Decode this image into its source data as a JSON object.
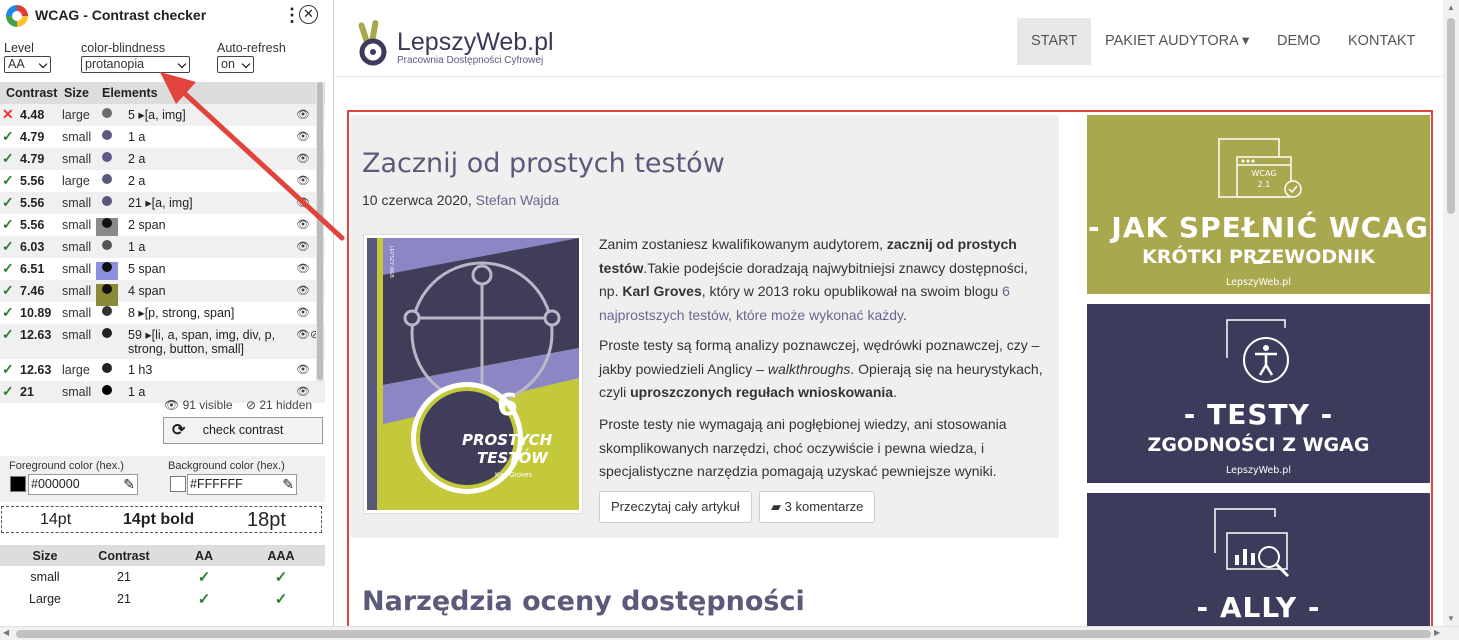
{
  "ext": {
    "title": "WCAG - Contrast checker",
    "menu_glyph": "⋮",
    "close_glyph": "✕",
    "level_label": "Level",
    "level_value": "AA",
    "cb_label": "color-blindness",
    "cb_value": "protanopia",
    "refresh_label": "Auto-refresh",
    "refresh_value": "on",
    "headers": {
      "contrast": "Contrast",
      "size": "Size",
      "elements": "Elements"
    },
    "rows": [
      {
        "ok": false,
        "contrast": "4.48",
        "size": "large",
        "swatch": "",
        "dot": "#6b6b6b",
        "count": "5 ▸[a, img]"
      },
      {
        "ok": true,
        "contrast": "4.79",
        "size": "small",
        "swatch": "",
        "dot": "#5c5a85",
        "count": "1 a"
      },
      {
        "ok": true,
        "contrast": "4.79",
        "size": "small",
        "swatch": "",
        "dot": "#5c5a85",
        "count": "2 a"
      },
      {
        "ok": true,
        "contrast": "5.56",
        "size": "large",
        "swatch": "",
        "dot": "#58587a",
        "count": "2 a"
      },
      {
        "ok": true,
        "contrast": "5.56",
        "size": "small",
        "swatch": "",
        "dot": "#58587a",
        "count": "21 ▸[a, img]"
      },
      {
        "ok": true,
        "contrast": "5.56",
        "size": "small",
        "swatch": "#8a8a8a",
        "dot": "#111111",
        "count": "2 span"
      },
      {
        "ok": true,
        "contrast": "6.03",
        "size": "small",
        "swatch": "",
        "dot": "#555555",
        "count": "1 a"
      },
      {
        "ok": true,
        "contrast": "6.51",
        "size": "small",
        "swatch": "#8a8fe0",
        "dot": "#111111",
        "count": "5 span"
      },
      {
        "ok": true,
        "contrast": "7.46",
        "size": "small",
        "swatch": "#8a8a3a",
        "dot": "#111111",
        "count": "4 span"
      },
      {
        "ok": true,
        "contrast": "10.89",
        "size": "small",
        "swatch": "",
        "dot": "#333333",
        "count": "8 ▸[p, strong, span]"
      },
      {
        "ok": true,
        "contrast": "12.63",
        "size": "small",
        "swatch": "",
        "dot": "#222222",
        "count": "59 ▸[li, a, span, img, div, p, strong, button, small]",
        "tall": true
      },
      {
        "ok": true,
        "contrast": "12.63",
        "size": "large",
        "swatch": "",
        "dot": "#222222",
        "count": "1 h3"
      },
      {
        "ok": true,
        "contrast": "21",
        "size": "small",
        "swatch": "",
        "dot": "#000000",
        "count": "1 a"
      }
    ],
    "visible": "👁 91 visible",
    "hidden": "21 hidden",
    "check_label": "check contrast",
    "fg_label": "Foreground color (hex.)",
    "fg_value": "#000000",
    "bg_label": "Background color (hex.)",
    "bg_value": "#FFFFFF",
    "sample_1": "14pt",
    "sample_2": "14pt bold",
    "sample_3": "18pt",
    "summary_headers": {
      "size": "Size",
      "contrast": "Contrast",
      "aa": "AA",
      "aaa": "AAA"
    },
    "summary_rows": [
      {
        "size": "small",
        "contrast": "21"
      },
      {
        "size": "Large",
        "contrast": "21"
      }
    ]
  },
  "site": {
    "logo_title": "LepszyWeb.pl",
    "logo_sub": "Pracownia Dostępności Cyfrowej",
    "nav": [
      "START",
      "PAKIET AUDYTORA ▾",
      "DEMO",
      "KONTAKT"
    ],
    "article_title": "Zacznij od prostych testów",
    "date": "10 czerwca 2020,",
    "author": "Stefan Wajda",
    "book_title_1": "PROSTYCH",
    "book_title_2": "TESTÓW",
    "book_num": "6",
    "book_author": "Karl Groves",
    "book_side": "LEPSZY WEB",
    "p1_a": "Zanim zostaniesz kwalifikowanym audytorem, ",
    "p1_b": "zacznij od prostych testów",
    "p1_c": ".Takie podejście doradzają najwybitniejsi znawcy dostępności, np. ",
    "p1_d": "Karl Groves",
    "p1_e": ", który w 2013 roku opublikował na swoim blogu ",
    "p1_link": "6 najprostszych testów, które może wykonać każdy",
    "p1_f": ".",
    "p2_a": "Proste testy są formą analizy poznawczej, wędrówki poznawczej, czy – jakby powiedzieli Anglicy – ",
    "p2_em": "walkthroughs",
    "p2_b": ". Opierają się na heurystykach, czyli ",
    "p2_strong": "uproszczonych regułach wnioskowania",
    "p2_c": ".",
    "p3": "Proste testy nie wymagają ani pogłębionej wiedzy, ani stosowania skomplikowanych narzędzi, choć oczywiście i pewna wiedza, i specjalistyczne narzędzia pomagają uzyskać pewniejsze wyniki.",
    "btn_read": "Przeczytaj cały artykuł",
    "btn_comments": "3 komentarze",
    "section_title": "Narzędzia oceny dostępności",
    "banner1": {
      "line1": "- JAK SPEŁNIĆ WCAG -",
      "line2": "KRÓTKI PRZEWODNIK",
      "site": "LepszyWeb.pl",
      "badge": "WCAG",
      "badge_ver": "2.1",
      "color": "#a9a84e"
    },
    "banner2": {
      "line1": "- TESTY -",
      "line2": "ZGODNOŚCI Z WGAG",
      "site": "LepszyWeb.pl",
      "color": "#3d3b5c"
    },
    "banner3": {
      "line1": "- ALLY -",
      "color": "#3d3b5c"
    }
  }
}
